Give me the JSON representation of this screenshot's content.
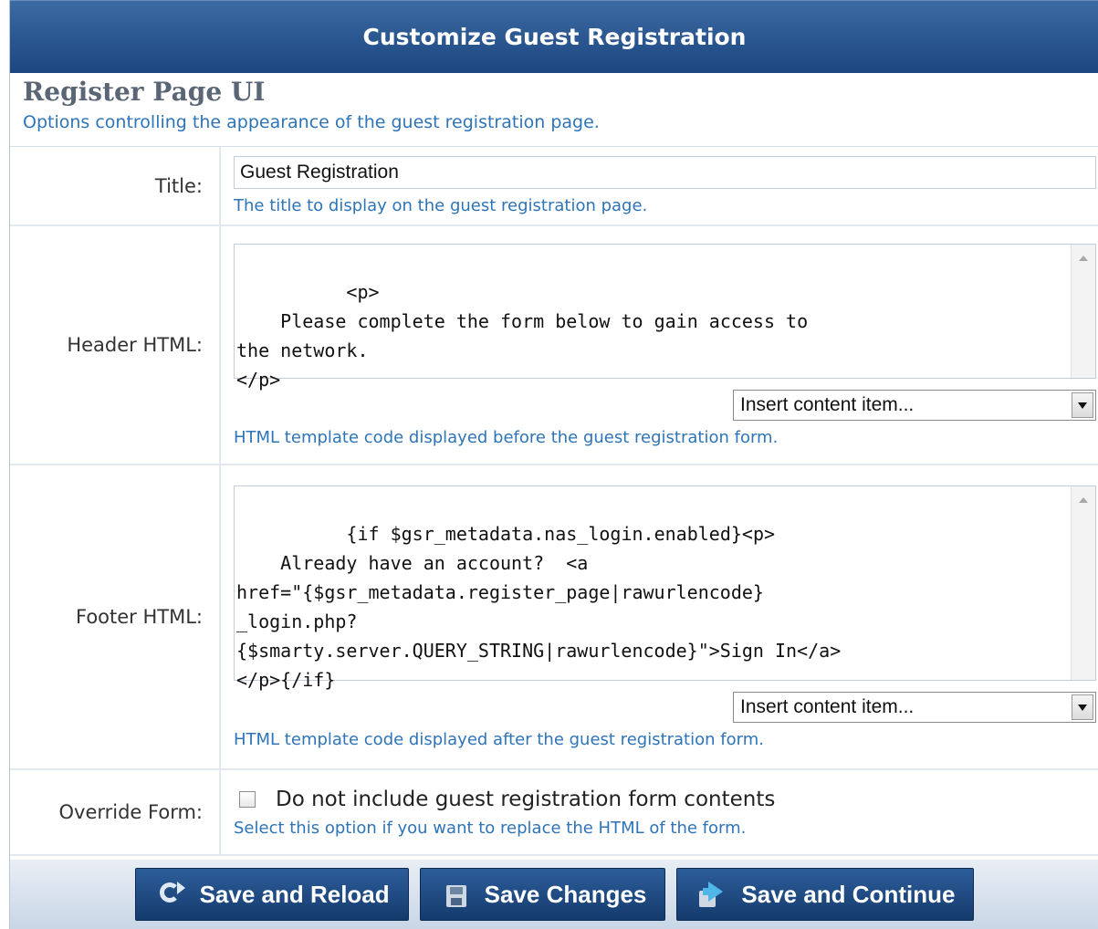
{
  "panel": {
    "title": "Customize Guest Registration"
  },
  "section": {
    "title": "Register Page UI",
    "description": "Options controlling the appearance of the guest registration page."
  },
  "fields": {
    "title": {
      "label": "Title:",
      "value": "Guest Registration",
      "hint": "The title to display on the guest registration page."
    },
    "header_html": {
      "label": "Header HTML:",
      "value": "<p>\n    Please complete the form below to gain access to\nthe network.\n</p>",
      "insert_select": "Insert content item...",
      "hint": "HTML template code displayed before the guest registration form."
    },
    "footer_html": {
      "label": "Footer HTML:",
      "value": "{if $gsr_metadata.nas_login.enabled}<p>\n    Already have an account?  <a\nhref=\"{$gsr_metadata.register_page|rawurlencode}\n_login.php?\n{$smarty.server.QUERY_STRING|rawurlencode}\">Sign In</a>\n</p>{/if}",
      "insert_select": "Insert content item...",
      "hint": "HTML template code displayed after the guest registration form."
    },
    "override_form": {
      "label": "Override Form:",
      "checkbox_label": "Do not include guest registration form contents",
      "checked": false,
      "hint": "Select this option if you want to replace the HTML of the form."
    }
  },
  "buttons": {
    "save_reload": "Save and Reload",
    "save_changes": "Save Changes",
    "save_continue": "Save and Continue"
  },
  "icons": {
    "save_reload": "reload-icon",
    "save_changes": "save-icon",
    "save_continue": "save-continue-icon",
    "scroll_up": "scroll-up-arrow-icon",
    "dropdown": "chevron-down-icon"
  },
  "colors": {
    "titlebar": "#1c4680",
    "hint_text": "#2e74b8",
    "button": "#1f4c85"
  }
}
